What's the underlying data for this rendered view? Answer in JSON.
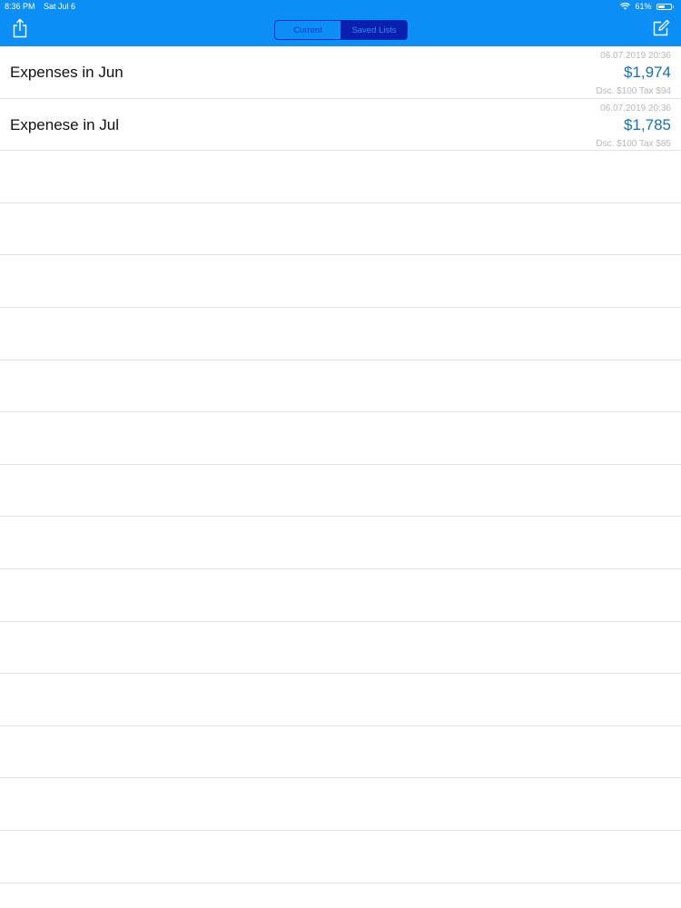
{
  "status_bar": {
    "time": "8:36 PM",
    "date": "Sat Jul 6",
    "battery_percent": "61%",
    "battery_level": 0.61,
    "icons": [
      "wifi-icon",
      "battery-icon"
    ]
  },
  "nav": {
    "left_icon": "share-icon",
    "right_icon": "compose-icon",
    "segments": [
      {
        "label": "Current",
        "selected": false
      },
      {
        "label": "Saved Lists",
        "selected": true
      }
    ]
  },
  "colors": {
    "nav_background": "#0b8ff6",
    "segment_selected_bg": "#0a1fb0",
    "amount": "#1a6fb0",
    "secondary_text": "#b8b8b8"
  },
  "saved_lists": [
    {
      "title": "Expenses in Jun",
      "date": "06.07.2019 20:36",
      "amount": "$1,974",
      "details": "Dsc. $100 Tax $94"
    },
    {
      "title": "Expenese in Jul",
      "date": "06.07.2019 20:36",
      "amount": "$1,785",
      "details": "Dsc. $100 Tax $85"
    }
  ]
}
